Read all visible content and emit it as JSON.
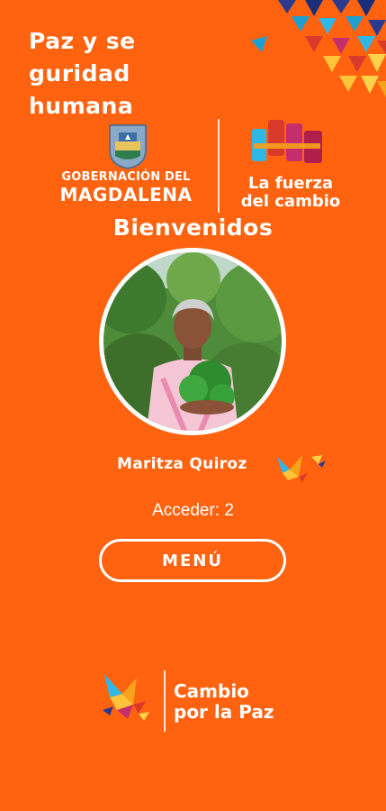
{
  "header": {
    "title_lines": [
      "Paz y se",
      "guridad",
      "humana"
    ]
  },
  "logos": {
    "gov_line1": "GOBERNACIÓN DEL",
    "gov_line2": "MAGDALENA",
    "fuerza_line1": "La fuerza",
    "fuerza_line2": "del cambio"
  },
  "welcome": "Bienvenidos",
  "user": {
    "name": "Maritza Quiroz"
  },
  "access_text": "Acceder: 2",
  "menu_label": "MENÚ",
  "footer": {
    "line1": "Cambio",
    "line2": "por la Paz"
  },
  "colors": {
    "background": "#FF6310",
    "text": "#FFFFFF"
  }
}
